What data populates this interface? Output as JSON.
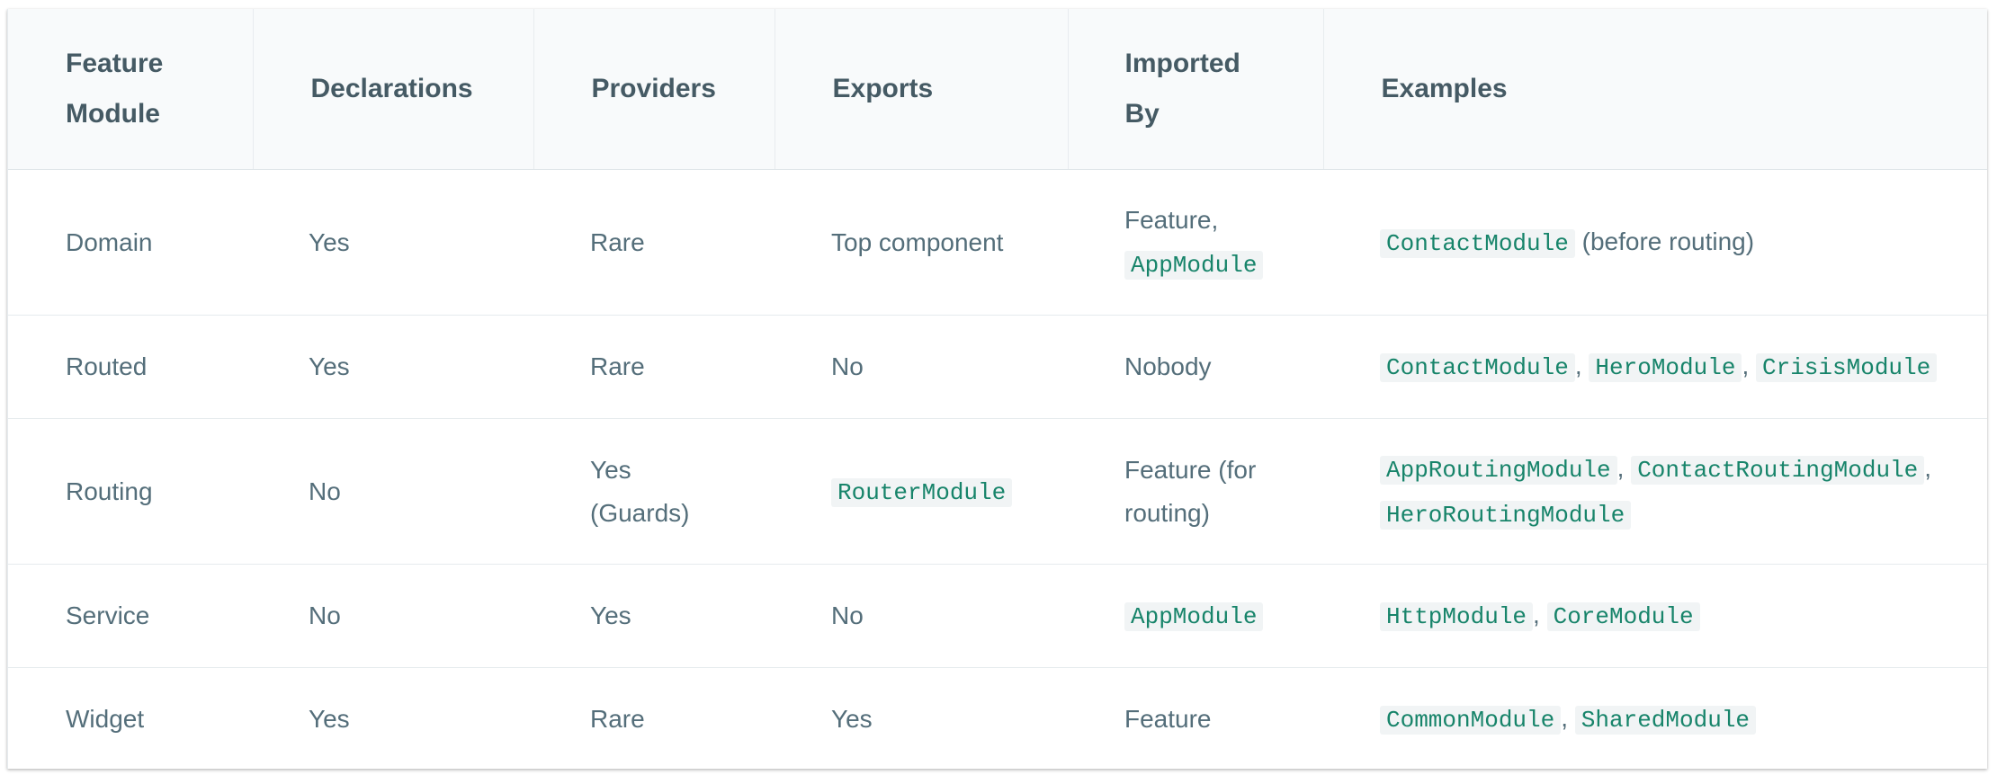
{
  "headers": {
    "feature_module": [
      "Feature",
      "Module"
    ],
    "declarations": "Declarations",
    "providers": "Providers",
    "exports": "Exports",
    "imported_by": [
      "Imported",
      "By"
    ],
    "examples": "Examples"
  },
  "rows": [
    {
      "feature_module": "Domain",
      "declarations": "Yes",
      "providers": "Rare",
      "exports": "Top component",
      "imported_by_text": "Feature,",
      "imported_by_code": "AppModule",
      "examples_code_1": "ContactModule",
      "examples_text": "(before routing)"
    },
    {
      "feature_module": "Routed",
      "declarations": "Yes",
      "providers": "Rare",
      "exports": "No",
      "imported_by": "Nobody",
      "examples_code_1": "ContactModule",
      "examples_code_2": "HeroModule",
      "examples_code_3": "CrisisModule"
    },
    {
      "feature_module": "Routing",
      "declarations": "No",
      "providers": [
        "Yes",
        "(Guards)"
      ],
      "exports_code": "RouterModule",
      "imported_by": [
        "Feature (for",
        "routing)"
      ],
      "examples_code_1": "AppRoutingModule",
      "examples_code_2": "ContactRoutingModule",
      "examples_code_3": "HeroRoutingModule"
    },
    {
      "feature_module": "Service",
      "declarations": "No",
      "providers": "Yes",
      "exports": "No",
      "imported_by_code": "AppModule",
      "examples_code_1": "HttpModule",
      "examples_code_2": "CoreModule"
    },
    {
      "feature_module": "Widget",
      "declarations": "Yes",
      "providers": "Rare",
      "exports": "Yes",
      "imported_by": "Feature",
      "examples_code_1": "CommonModule",
      "examples_code_2": "SharedModule"
    }
  ],
  "separator": ",",
  "colors": {
    "header_bg": "#f8fafb",
    "header_text": "#455a64",
    "body_text": "#546e7a",
    "code_text": "#17846a",
    "code_bg": "#f1f4f5"
  }
}
